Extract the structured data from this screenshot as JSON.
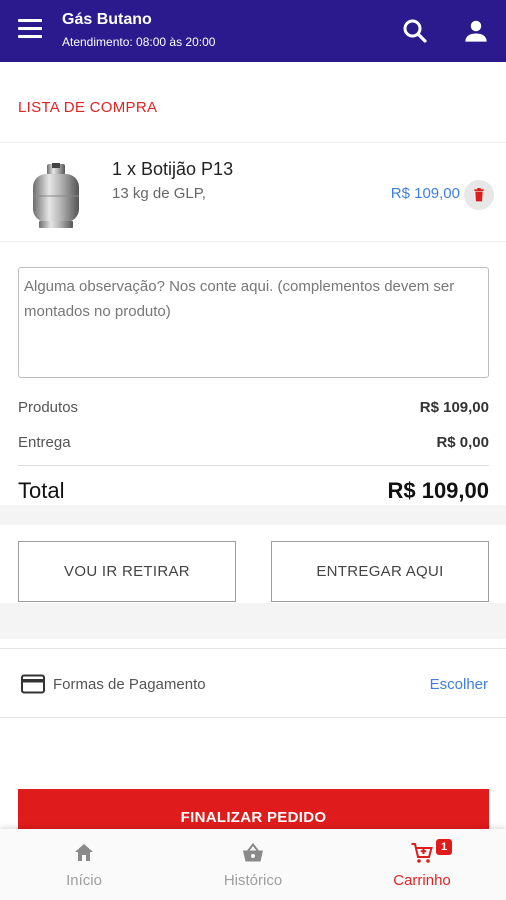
{
  "header": {
    "title": "Gás Butano",
    "subtitle": "Atendimento: 08:00 às 20:00",
    "menu_icon": "menu-icon",
    "search_icon": "search-icon",
    "account_icon": "account-icon"
  },
  "cart": {
    "section_title": "LISTA DE COMPRA",
    "items": [
      {
        "name": "1 x Botijão P13",
        "description": "13 kg de GLP,",
        "price": "R$ 109,00",
        "delete_icon": "trash-icon"
      }
    ]
  },
  "notes": {
    "placeholder": "Alguma observação? Nos conte aqui. (complementos devem ser montados no produto)"
  },
  "summary": {
    "products_label": "Produtos",
    "products_value": "R$ 109,00",
    "delivery_label": "Entrega",
    "delivery_value": "R$ 0,00",
    "total_label": "Total",
    "total_value": "R$ 109,00"
  },
  "options": {
    "pickup_label": "VOU IR RETIRAR",
    "delivery_label": "ENTREGAR AQUI"
  },
  "payment": {
    "label": "Formas de Pagamento",
    "action": "Escolher",
    "icon": "credit-card-icon"
  },
  "finalize_label": "FINALIZAR PEDIDO",
  "bottom_nav": {
    "items": [
      {
        "label": "Início",
        "icon": "home-icon"
      },
      {
        "label": "Histórico",
        "icon": "basket-icon"
      },
      {
        "label": "Carrinho",
        "icon": "cart-icon"
      }
    ],
    "cart_badge": "1"
  },
  "colors": {
    "primary": "#2a1a8e",
    "accent": "#e01b1b",
    "link": "#3f7fe0"
  }
}
